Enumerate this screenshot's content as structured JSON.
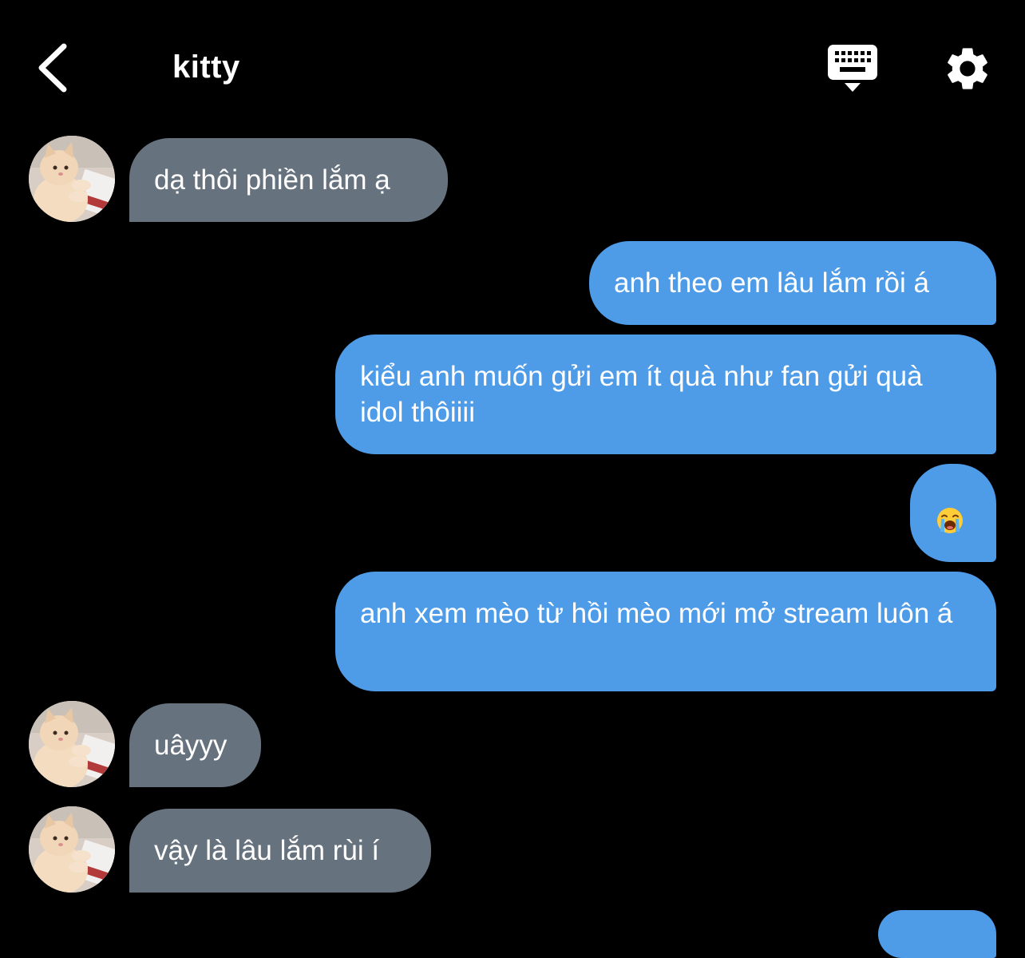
{
  "header": {
    "title": "kitty",
    "back_icon": "chevron-left-icon",
    "keyboard_icon": "keyboard-icon",
    "settings_icon": "gear-icon"
  },
  "colors": {
    "background": "#000000",
    "incoming_bubble": "#67727f",
    "outgoing_bubble": "#4e9be8",
    "text": "#ffffff"
  },
  "messages": [
    {
      "direction": "incoming",
      "text": "dạ thôi phiền lắm ạ"
    },
    {
      "direction": "outgoing",
      "text": "anh theo em lâu lắm rồi á"
    },
    {
      "direction": "outgoing",
      "text": "kiểu anh muốn gửi em ít quà như fan gửi quà idol thôiiii"
    },
    {
      "direction": "outgoing",
      "emoji": "loudly-crying-face-emoji"
    },
    {
      "direction": "outgoing",
      "text": "anh xem mèo từ hồi mèo mới mở stream luôn á"
    },
    {
      "direction": "incoming",
      "text": "uâyyy"
    },
    {
      "direction": "incoming",
      "text": "vậy là lâu lắm rùi í"
    }
  ]
}
